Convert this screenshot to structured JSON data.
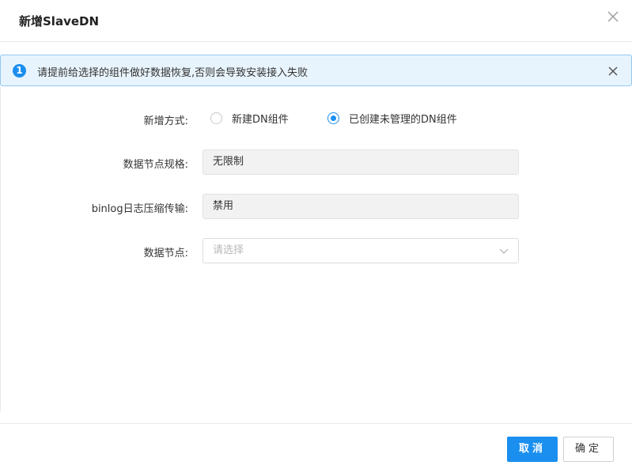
{
  "dialog": {
    "title": "新增SlaveDN"
  },
  "alert": {
    "icon_text": "1",
    "message": "请提前给选择的组件做好数据恢复,否则会导致安装接入失败"
  },
  "form": {
    "mode": {
      "label": "新增方式:",
      "options": [
        {
          "label": "新建DN组件",
          "checked": false
        },
        {
          "label": "已创建未管理的DN组件",
          "checked": true
        }
      ]
    },
    "spec": {
      "label": "数据节点规格:",
      "value": "无限制"
    },
    "binlog": {
      "label": "binlog日志压缩传输:",
      "value": "禁用"
    },
    "node": {
      "label": "数据节点:",
      "placeholder": "请选择"
    }
  },
  "footer": {
    "confirm_label": "取消",
    "cancel_label": "确定"
  },
  "colors": {
    "primary": "#1a8ff0",
    "alert_bg": "#e8f4fd",
    "alert_border": "#91c7f0"
  }
}
